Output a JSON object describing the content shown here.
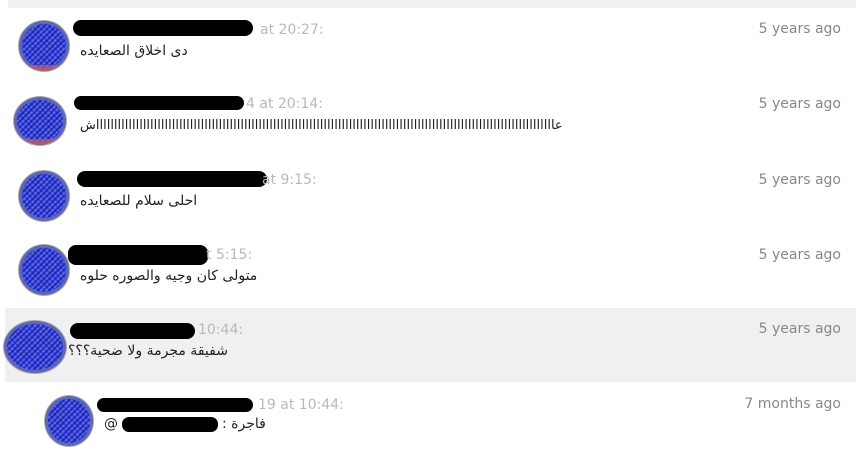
{
  "comments": [
    {
      "time": "at 20:27:",
      "age": "5 years ago",
      "text": "دى اخلاق الصعايده"
    },
    {
      "time": "4 at 20:14:",
      "age": "5 years ago",
      "text": "عاااااااااااااااااااااااااااااااااااااااااااااااااااااااااااااااااااااااااااااااااااااااااااااااااااااااااااااااااااااااااااااااش"
    },
    {
      "time": "at 9:15:",
      "age": "5 years ago",
      "text": "احلى سلام للصعايده"
    },
    {
      "time": "t 5:15:",
      "age": "5 years ago",
      "text": "متولى كان وجيه والصوره حلوه"
    },
    {
      "time": "10:44:",
      "age": "5 years ago",
      "text": "شفيقة مجرمة ولا ضحية؟؟؟"
    },
    {
      "time": "19 at 10:44:",
      "age": "7 months ago",
      "text": "فاجرة :",
      "mention_prefix": "@"
    }
  ]
}
